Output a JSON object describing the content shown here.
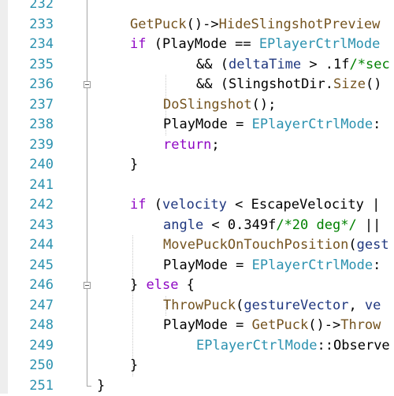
{
  "editor": {
    "lines": [
      {
        "num": "232",
        "indent": 0,
        "tokens": []
      },
      {
        "num": "233",
        "indent": 1,
        "tokens": [
          [
            "fn",
            "GetPuck"
          ],
          [
            "plain",
            "()->"
          ],
          [
            "fn",
            "HideSlingshotPreview"
          ]
        ]
      },
      {
        "num": "234",
        "indent": 1,
        "tokens": [
          [
            "kw",
            "if"
          ],
          [
            "plain",
            " ("
          ],
          [
            "mem",
            "PlayMode"
          ],
          [
            "plain",
            " == "
          ],
          [
            "type",
            "EPlayerCtrlMode"
          ]
        ]
      },
      {
        "num": "235",
        "indent": 3,
        "tokens": [
          [
            "plain",
            "&& ("
          ],
          [
            "var",
            "deltaTime"
          ],
          [
            "plain",
            " > "
          ],
          [
            "num",
            ".1f"
          ],
          [
            "cmt",
            "/*sec"
          ]
        ]
      },
      {
        "num": "236",
        "indent": 3,
        "fold": true,
        "tokens": [
          [
            "plain",
            "&& ("
          ],
          [
            "mem",
            "SlingshotDir"
          ],
          [
            "plain",
            "."
          ],
          [
            "fn",
            "Size"
          ],
          [
            "plain",
            "()"
          ]
        ]
      },
      {
        "num": "237",
        "indent": 2,
        "tokens": [
          [
            "fn",
            "DoSlingshot"
          ],
          [
            "plain",
            "();"
          ]
        ]
      },
      {
        "num": "238",
        "indent": 2,
        "tokens": [
          [
            "mem",
            "PlayMode"
          ],
          [
            "plain",
            " = "
          ],
          [
            "type",
            "EPlayerCtrlMode"
          ],
          [
            "plain",
            ":"
          ]
        ]
      },
      {
        "num": "239",
        "indent": 2,
        "tokens": [
          [
            "kw",
            "return"
          ],
          [
            "plain",
            ";"
          ]
        ]
      },
      {
        "num": "240",
        "indent": 1,
        "tokens": [
          [
            "plain",
            "}"
          ]
        ]
      },
      {
        "num": "241",
        "indent": 0,
        "tokens": []
      },
      {
        "num": "242",
        "indent": 1,
        "tokens": [
          [
            "kw",
            "if"
          ],
          [
            "plain",
            " ("
          ],
          [
            "var",
            "velocity"
          ],
          [
            "plain",
            " < "
          ],
          [
            "mem",
            "EscapeVelocity"
          ],
          [
            "plain",
            " |"
          ]
        ]
      },
      {
        "num": "243",
        "indent": 2,
        "tokens": [
          [
            "var",
            "angle"
          ],
          [
            "plain",
            " < "
          ],
          [
            "num",
            "0.349f"
          ],
          [
            "cmt",
            "/*20 deg*/"
          ],
          [
            "plain",
            " ||"
          ]
        ]
      },
      {
        "num": "244",
        "indent": 2,
        "tokens": [
          [
            "fn",
            "MovePuckOnTouchPosition"
          ],
          [
            "plain",
            "("
          ],
          [
            "var",
            "gest"
          ]
        ]
      },
      {
        "num": "245",
        "indent": 2,
        "tokens": [
          [
            "mem",
            "PlayMode"
          ],
          [
            "plain",
            " = "
          ],
          [
            "type",
            "EPlayerCtrlMode"
          ],
          [
            "plain",
            ":"
          ]
        ]
      },
      {
        "num": "246",
        "indent": 1,
        "fold": true,
        "tokens": [
          [
            "plain",
            "} "
          ],
          [
            "kw",
            "else"
          ],
          [
            "plain",
            " {"
          ]
        ]
      },
      {
        "num": "247",
        "indent": 2,
        "tokens": [
          [
            "fn",
            "ThrowPuck"
          ],
          [
            "plain",
            "("
          ],
          [
            "var",
            "gestureVector"
          ],
          [
            "plain",
            ", "
          ],
          [
            "var",
            "ve"
          ]
        ]
      },
      {
        "num": "248",
        "indent": 2,
        "tokens": [
          [
            "mem",
            "PlayMode"
          ],
          [
            "plain",
            " = "
          ],
          [
            "fn",
            "GetPuck"
          ],
          [
            "plain",
            "()->"
          ],
          [
            "fn",
            "Throw"
          ]
        ]
      },
      {
        "num": "249",
        "indent": 3,
        "tokens": [
          [
            "type",
            "EPlayerCtrlMode"
          ],
          [
            "plain",
            "::"
          ],
          [
            "mem",
            "Observe"
          ]
        ]
      },
      {
        "num": "250",
        "indent": 1,
        "tokens": [
          [
            "plain",
            "}"
          ]
        ]
      },
      {
        "num": "251",
        "indent": 0,
        "close": true,
        "tokens": [
          [
            "plain",
            "}"
          ]
        ]
      }
    ]
  }
}
